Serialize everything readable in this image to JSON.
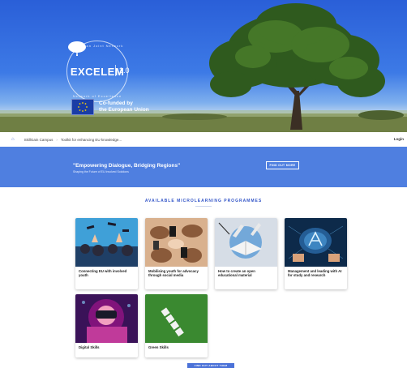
{
  "hero": {
    "logo": {
      "ring_top": "European Joint Network",
      "ring_bottom": "Network of Excellence",
      "name": "EXCELEM",
      "version": "2.0"
    },
    "eu": {
      "line1": "Co-funded by",
      "line2": "the European Union"
    }
  },
  "breadcrumb": {
    "items": [
      "SkillGain Campus",
      "Toolkit for enhancing EU knowledge..."
    ],
    "right_label": "Login"
  },
  "banner": {
    "title": "\"Empowering Dialogue, Bridging Regions\"",
    "subtitle": "Shaping the Future of EU Involved Solutions",
    "button_label": "FIND OUT MORE"
  },
  "section": {
    "title": "AVAILABLE MICROLEARNING PROGRAMMES"
  },
  "cards": [
    {
      "label": "Connecting EU with involved youth",
      "icon": "graduation-photo"
    },
    {
      "label": "Mobilising youth for advocacy through social media",
      "icon": "hands-phones-photo"
    },
    {
      "label": "How to create an open educational material",
      "icon": "open-book-photo"
    },
    {
      "label": "Management and leading with AI for study and research",
      "icon": "ai-brain-photo"
    },
    {
      "label": "Digital Skills",
      "icon": "vr-headset-photo"
    },
    {
      "label": "Green Skills",
      "icon": "green-grass-photo"
    }
  ],
  "cta": {
    "label": "FIND OUT ABOUT THEM"
  },
  "colors": {
    "primary": "#4f7fe0",
    "heading": "#3456c8",
    "eu_blue": "#1a3da6"
  }
}
